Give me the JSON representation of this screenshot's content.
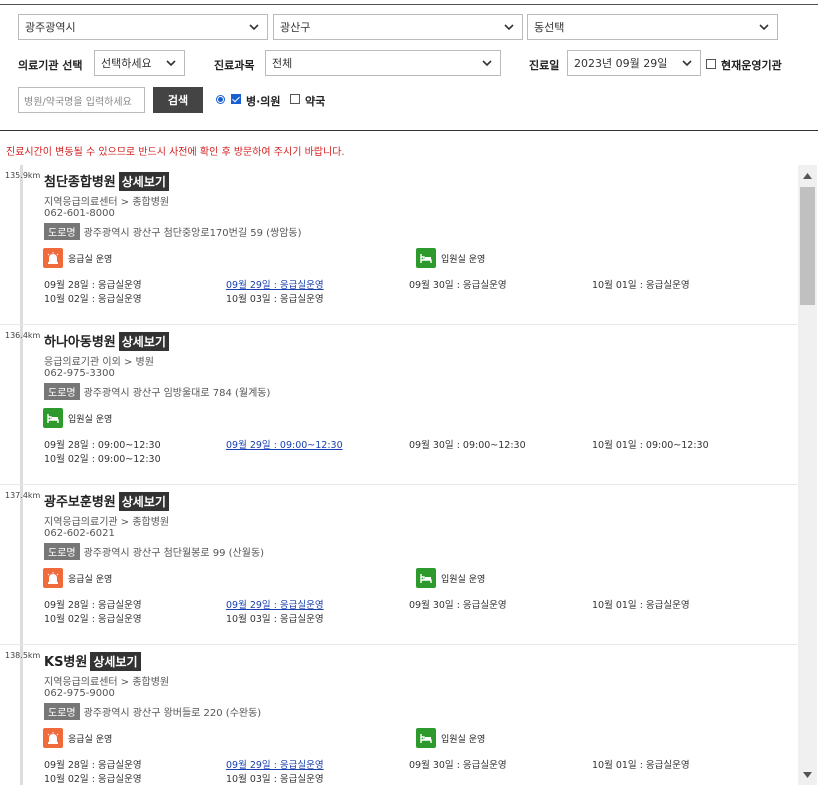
{
  "filters": {
    "region": "광주광역시",
    "district": "광산구",
    "dong": "동선택",
    "institution_label": "의료기관 선택",
    "institution_value": "선택하세요",
    "department_label": "진료과목",
    "department_value": "전체",
    "date_label": "진료일",
    "date_value": "2023년 09월 29일",
    "open_now_label": "현재운영기관",
    "search_placeholder": "병원/약국명을 입력하세요",
    "search_button": "검색",
    "type_hospital": "병·의원",
    "type_pharmacy": "약국"
  },
  "notice": "진료시간이 변동될 수 있으므로 반드시 사전에 확인 후 방문하여 주시기 바랍니다.",
  "detail_label": "상세보기",
  "road_label": "도로명",
  "features": {
    "emergency": "응급실 운영",
    "inpatient": "입원실 운영"
  },
  "hospitals": [
    {
      "distance": "135.9km",
      "name": "첨단종합병원",
      "category": "지역응급의료센터 > 종합병원",
      "phone": "062-601-8000",
      "address": "광주광역시 광산구 첨단중앙로170번길 59 (쌍암동)",
      "schedule": [
        "09월 28일 : 응급실운영",
        "09월 29일 : 응급실운영",
        "09월 30일 : 응급실운영",
        "10월 01일 : 응급실운영",
        "10월 02일 : 응급실운영",
        "10월 03일 : 응급실운영"
      ]
    },
    {
      "distance": "136.4km",
      "name": "하나아동병원",
      "category": "응급의료기관 이외 > 병원",
      "phone": "062-975-3300",
      "address": "광주광역시 광산구 임방울대로 784 (월계동)",
      "schedule": [
        "09월 28일 : 09:00~12:30",
        "09월 29일 : 09:00~12:30",
        "09월 30일 : 09:00~12:30",
        "10월 01일 : 09:00~12:30",
        "10월 02일 : 09:00~12:30"
      ]
    },
    {
      "distance": "137.4km",
      "name": "광주보훈병원",
      "category": "지역응급의료기관 > 종합병원",
      "phone": "062-602-6021",
      "address": "광주광역시 광산구 첨단월봉로 99 (산월동)",
      "schedule": [
        "09월 28일 : 응급실운영",
        "09월 29일 : 응급실운영",
        "09월 30일 : 응급실운영",
        "10월 01일 : 응급실운영",
        "10월 02일 : 응급실운영",
        "10월 03일 : 응급실운영"
      ]
    },
    {
      "distance": "138.5km",
      "name": "KS병원",
      "category": "지역응급의료센터 > 종합병원",
      "phone": "062-975-9000",
      "address": "광주광역시 광산구 왕버들로 220 (수완동)",
      "schedule": [
        "09월 28일 : 응급실운영",
        "09월 29일 : 응급실운영",
        "09월 30일 : 응급실운영",
        "10월 01일 : 응급실운영",
        "10월 02일 : 응급실운영",
        "10월 03일 : 응급실운영"
      ]
    }
  ]
}
